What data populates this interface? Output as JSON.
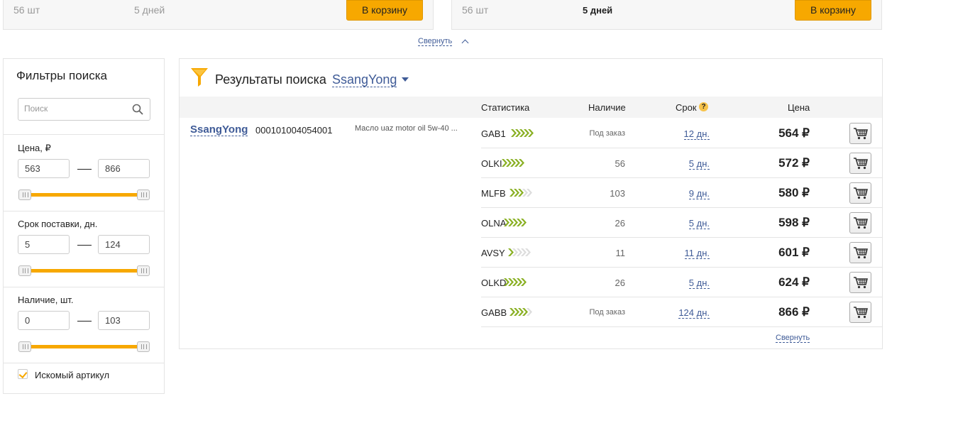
{
  "top_cards": [
    {
      "qty": "56 шт",
      "days": "5 дней",
      "button": "В корзину"
    },
    {
      "qty": "56 шт",
      "days": "5 дней",
      "button": "В корзину"
    }
  ],
  "collapse_label": "Свернуть",
  "filters": {
    "title": "Фильтры поиска",
    "search_placeholder": "Поиск",
    "price": {
      "label": "Цена, ₽",
      "min": "563",
      "max": "866"
    },
    "delivery": {
      "label": "Срок поставки, дн.",
      "min": "5",
      "max": "124"
    },
    "stock": {
      "label": "Наличие, шт.",
      "min": "0",
      "max": "103"
    },
    "exact_article_label": "Искомый артикул",
    "exact_article_checked": true
  },
  "results": {
    "title": "Результаты поиска",
    "brand": "SsangYong",
    "columns": {
      "stats": "Статистика",
      "availability": "Наличие",
      "term": "Срок",
      "price": "Цена"
    },
    "help_glyph": "?",
    "article": {
      "brand": "SsangYong",
      "number": "000101004054001",
      "description": "Масло uaz motor oil 5w-40 ..."
    },
    "rows": [
      {
        "code": "GAB1",
        "rating": 5,
        "availability": "Под заказ",
        "term": "12 дн.",
        "price": "564 ₽"
      },
      {
        "code": "OLKI",
        "rating": 5,
        "availability": "56",
        "term": "5 дн.",
        "price": "572 ₽"
      },
      {
        "code": "MLFB",
        "rating": 3,
        "availability": "103",
        "term": "9 дн.",
        "price": "580 ₽"
      },
      {
        "code": "OLNA",
        "rating": 5,
        "availability": "26",
        "term": "5 дн.",
        "price": "598 ₽"
      },
      {
        "code": "AVSY",
        "rating": 1,
        "availability": "11",
        "term": "11 дн.",
        "price": "601 ₽"
      },
      {
        "code": "OLKD",
        "rating": 5,
        "availability": "26",
        "term": "5 дн.",
        "price": "624 ₽"
      },
      {
        "code": "GABB",
        "rating": 4,
        "availability": "Под заказ",
        "term": "124 дн.",
        "price": "866 ₽"
      }
    ],
    "collapse_label": "Свернуть"
  },
  "colors": {
    "accent": "#f7a800",
    "link": "#3f5b97",
    "rating_on": "#8ab024",
    "rating_off": "#dddddd"
  },
  "icons": [
    "search-icon",
    "funnel-icon",
    "cart-icon",
    "chevron-up-icon",
    "caret-down-icon",
    "checkmark-icon",
    "rating-arrows-icon"
  ]
}
